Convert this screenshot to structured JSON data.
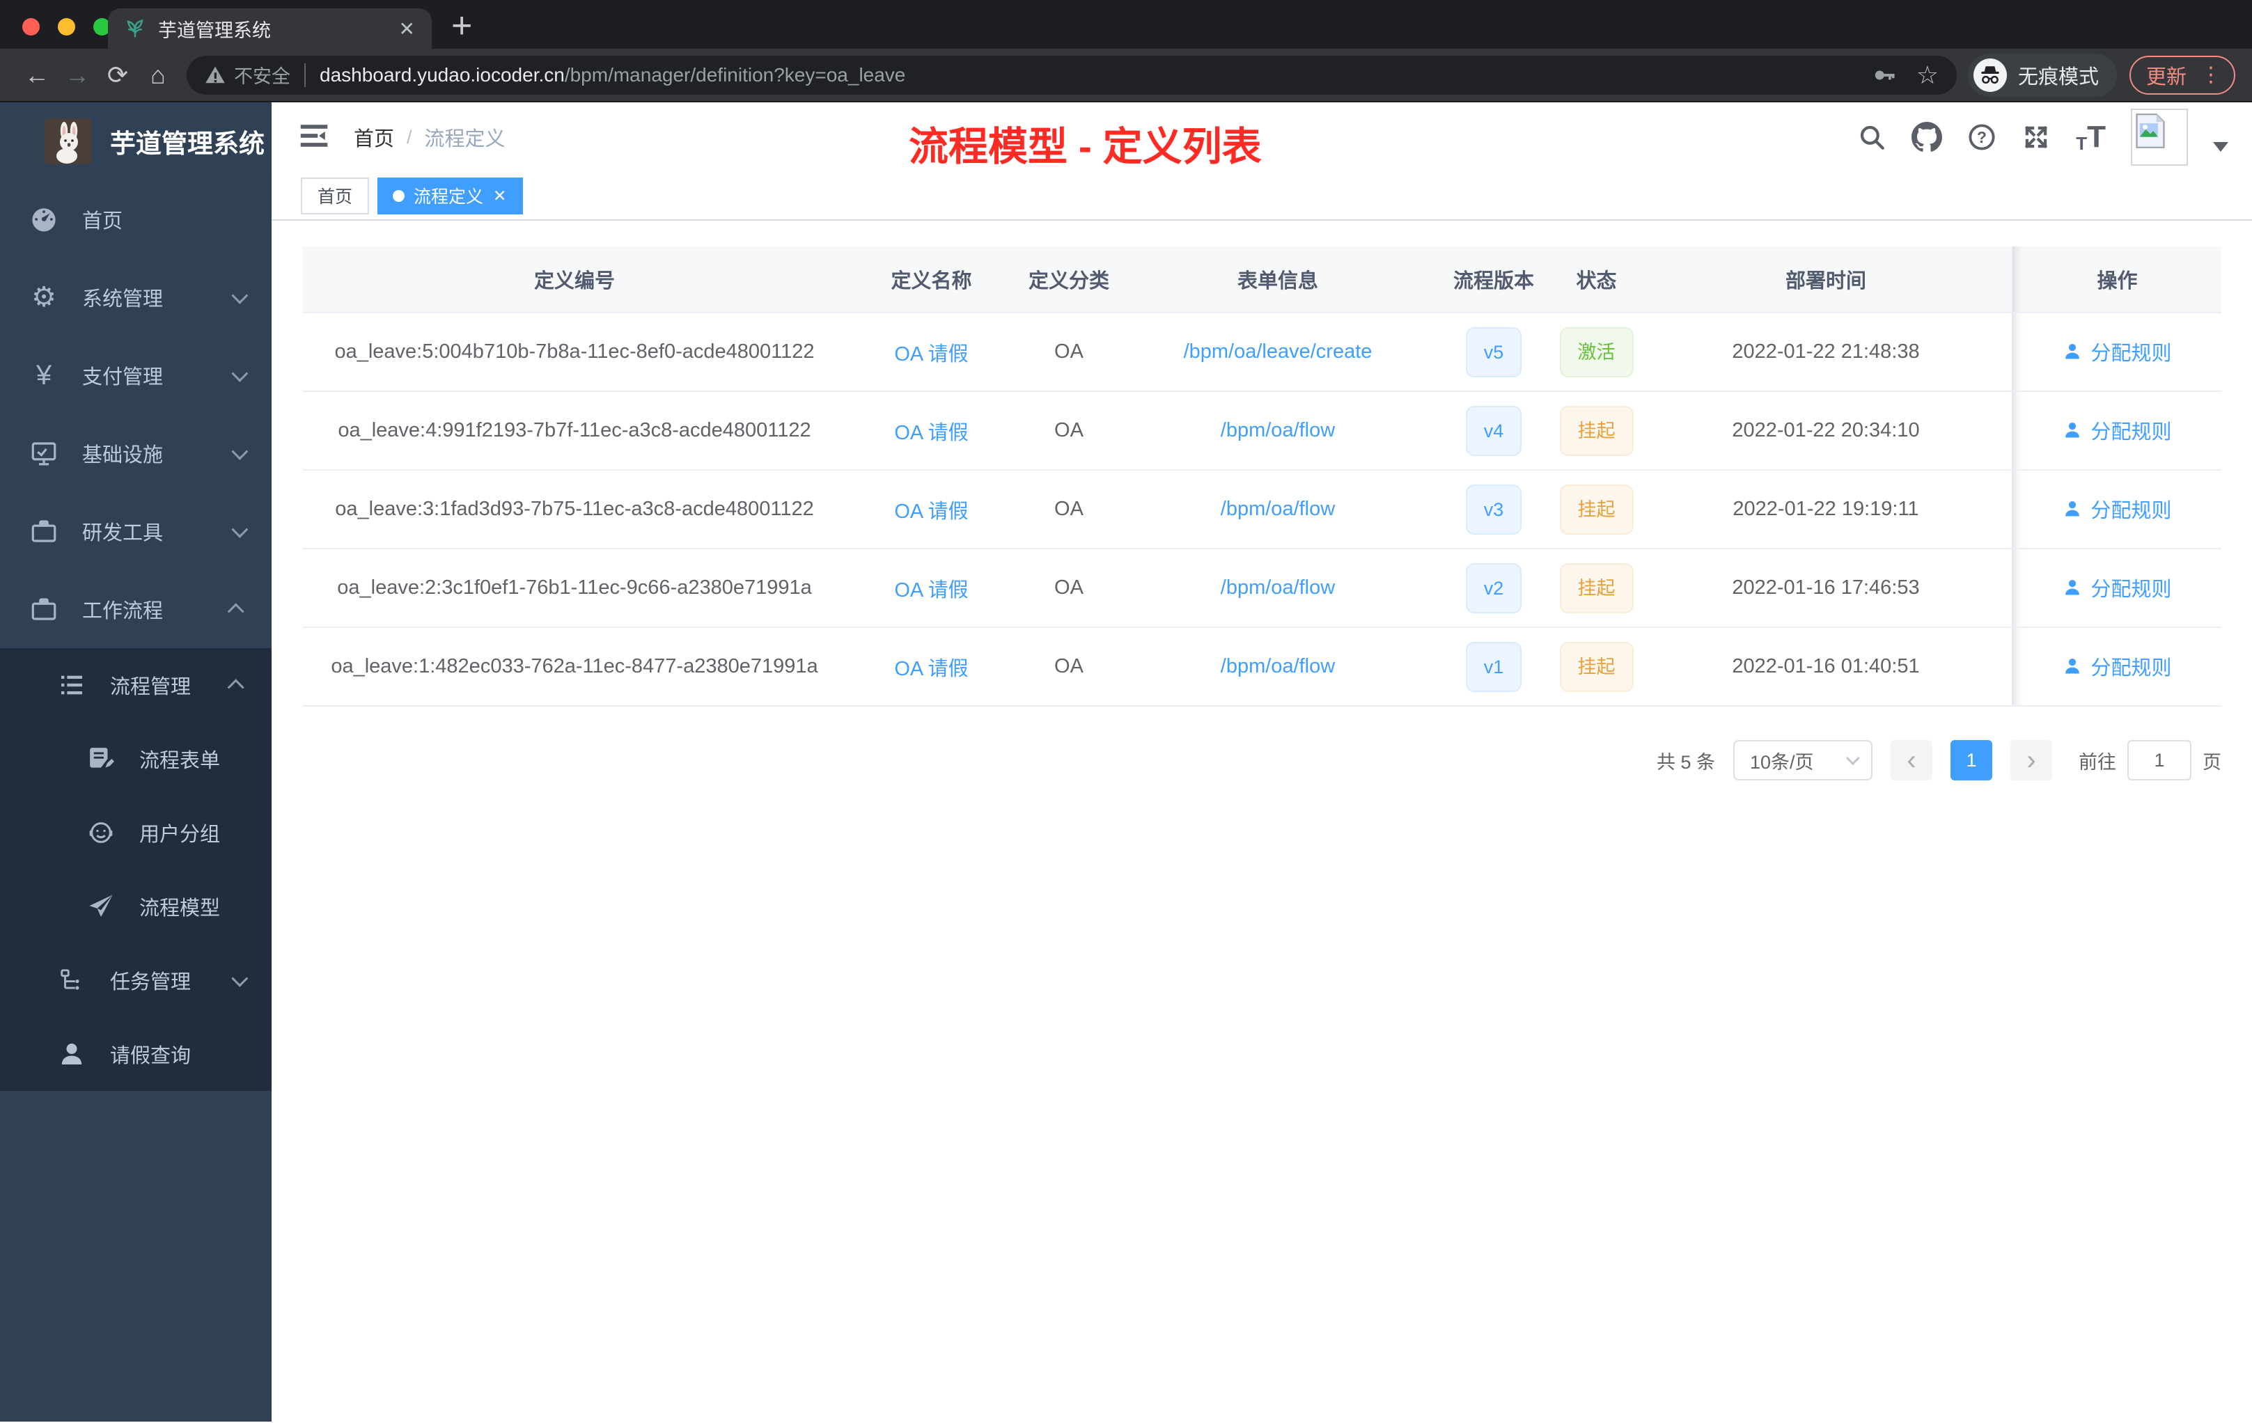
{
  "browser": {
    "tab_title": "芋道管理系统",
    "security_label": "不安全",
    "url_host": "dashboard.yudao.iocoder.cn",
    "url_path": "/bpm/manager/definition?key=oa_leave",
    "incognito_label": "无痕模式",
    "update_label": "更新"
  },
  "sidebar": {
    "logo_title": "芋道管理系统",
    "items": [
      {
        "label": "首页",
        "icon": "dashboard-icon",
        "state": "none"
      },
      {
        "label": "系统管理",
        "icon": "gear-icon",
        "state": "collapsed"
      },
      {
        "label": "支付管理",
        "icon": "yuan-icon",
        "state": "collapsed"
      },
      {
        "label": "基础设施",
        "icon": "monitor-icon",
        "state": "collapsed"
      },
      {
        "label": "研发工具",
        "icon": "briefcase-icon",
        "state": "collapsed"
      },
      {
        "label": "工作流程",
        "icon": "briefcase-icon",
        "state": "expanded"
      },
      {
        "label": "流程管理",
        "icon": "list-tree-icon",
        "state": "expanded"
      },
      {
        "label": "流程表单",
        "icon": "form-edit-icon",
        "state": "none"
      },
      {
        "label": "用户分组",
        "icon": "robot-icon",
        "state": "none"
      },
      {
        "label": "流程模型",
        "icon": "paper-plane-icon",
        "state": "none"
      },
      {
        "label": "任务管理",
        "icon": "branch-icon",
        "state": "collapsed"
      },
      {
        "label": "请假查询",
        "icon": "user-icon",
        "state": "none"
      }
    ]
  },
  "header": {
    "breadcrumb_home": "首页",
    "breadcrumb_separator": "/",
    "breadcrumb_current": "流程定义",
    "annotation": "流程模型 - 定义列表",
    "icons": [
      "search-icon",
      "github-icon",
      "help-icon",
      "fullscreen-icon",
      "font-size-icon",
      "avatar",
      "caret-down-icon"
    ]
  },
  "tags": {
    "home": "首页",
    "active": "流程定义"
  },
  "table": {
    "columns": [
      "定义编号",
      "定义名称",
      "定义分类",
      "表单信息",
      "流程版本",
      "状态",
      "部署时间",
      "操作"
    ],
    "rows": [
      {
        "id": "oa_leave:5:004b710b-7b8a-11ec-8ef0-acde48001122",
        "name": "OA 请假",
        "category": "OA",
        "form": "/bpm/oa/leave/create",
        "version": "v5",
        "status": "激活",
        "deploy_time": "2022-01-22 21:48:38",
        "action": "分配规则"
      },
      {
        "id": "oa_leave:4:991f2193-7b7f-11ec-a3c8-acde48001122",
        "name": "OA 请假",
        "category": "OA",
        "form": "/bpm/oa/flow",
        "version": "v4",
        "status": "挂起",
        "deploy_time": "2022-01-22 20:34:10",
        "action": "分配规则"
      },
      {
        "id": "oa_leave:3:1fad3d93-7b75-11ec-a3c8-acde48001122",
        "name": "OA 请假",
        "category": "OA",
        "form": "/bpm/oa/flow",
        "version": "v3",
        "status": "挂起",
        "deploy_time": "2022-01-22 19:19:11",
        "action": "分配规则"
      },
      {
        "id": "oa_leave:2:3c1f0ef1-76b1-11ec-9c66-a2380e71991a",
        "name": "OA 请假",
        "category": "OA",
        "form": "/bpm/oa/flow",
        "version": "v2",
        "status": "挂起",
        "deploy_time": "2022-01-16 17:46:53",
        "action": "分配规则"
      },
      {
        "id": "oa_leave:1:482ec033-762a-11ec-8477-a2380e71991a",
        "name": "OA 请假",
        "category": "OA",
        "form": "/bpm/oa/flow",
        "version": "v1",
        "status": "挂起",
        "deploy_time": "2022-01-16 01:40:51",
        "action": "分配规则"
      }
    ]
  },
  "pagination": {
    "total": "共 5 条",
    "page_size": "10条/页",
    "current_page": "1",
    "goto_label": "前往",
    "goto_value": "1",
    "goto_suffix": "页"
  },
  "colors": {
    "accent_blue": "#409eff",
    "success_green": "#67c23a",
    "warning_orange": "#e6a23c",
    "annotation_red": "#fe2b25",
    "sidebar_bg": "#304156",
    "submenu_bg": "#1f2d3d",
    "chrome_bg": "#35363a"
  }
}
